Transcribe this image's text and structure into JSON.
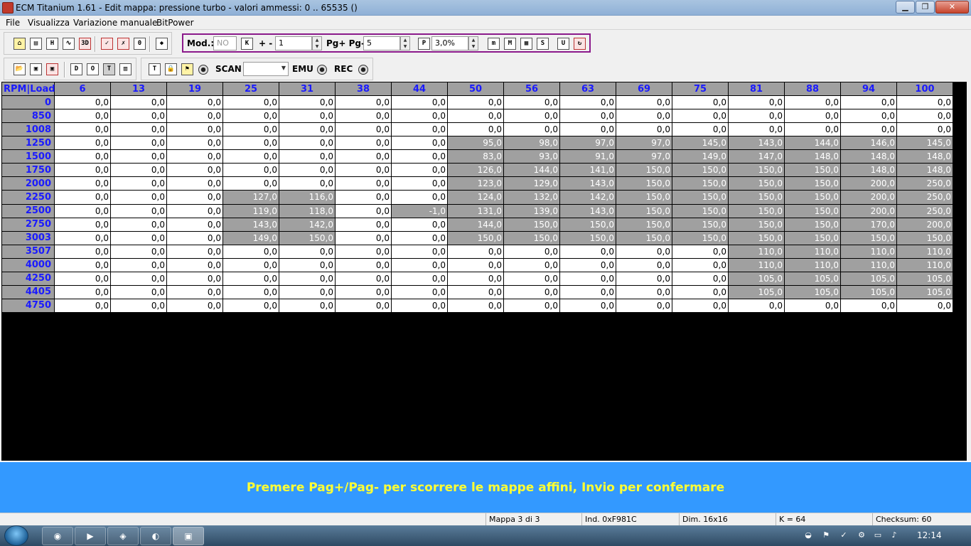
{
  "window": {
    "title": "ECM Titanium 1.61 - Edit mappa: pressione turbo - valori ammessi: 0 .. 65535 ()"
  },
  "menu": [
    "File",
    "Visualizza",
    "Variazione manuale",
    "BitPower"
  ],
  "toolbar1": {
    "mod_label": "Mod.:",
    "mod_value": "NO",
    "plusminus_label": "+ -",
    "step_value": "1",
    "page_label": "Pg+ Pg-",
    "page_value": "5",
    "percent_value": "3,0%"
  },
  "toolbar2": {
    "scan_label": "SCAN",
    "emu_label": "EMU",
    "rec_label": "REC"
  },
  "map": {
    "corner": "RPM|Load",
    "columns": [
      "6",
      "13",
      "19",
      "25",
      "31",
      "38",
      "44",
      "50",
      "56",
      "63",
      "69",
      "75",
      "81",
      "88",
      "94",
      "100"
    ],
    "rows": [
      {
        "rpm": "0",
        "values": [
          "0,0",
          "0,0",
          "0,0",
          "0,0",
          "0,0",
          "0,0",
          "0,0",
          "0,0",
          "0,0",
          "0,0",
          "0,0",
          "0,0",
          "0,0",
          "0,0",
          "0,0",
          "0,0"
        ]
      },
      {
        "rpm": "850",
        "values": [
          "0,0",
          "0,0",
          "0,0",
          "0,0",
          "0,0",
          "0,0",
          "0,0",
          "0,0",
          "0,0",
          "0,0",
          "0,0",
          "0,0",
          "0,0",
          "0,0",
          "0,0",
          "0,0"
        ]
      },
      {
        "rpm": "1008",
        "values": [
          "0,0",
          "0,0",
          "0,0",
          "0,0",
          "0,0",
          "0,0",
          "0,0",
          "0,0",
          "0,0",
          "0,0",
          "0,0",
          "0,0",
          "0,0",
          "0,0",
          "0,0",
          "0,0"
        ]
      },
      {
        "rpm": "1250",
        "values": [
          "0,0",
          "0,0",
          "0,0",
          "0,0",
          "0,0",
          "0,0",
          "0,0",
          "95,0",
          "98,0",
          "97,0",
          "97,0",
          "145,0",
          "143,0",
          "144,0",
          "146,0",
          "145,0"
        ]
      },
      {
        "rpm": "1500",
        "values": [
          "0,0",
          "0,0",
          "0,0",
          "0,0",
          "0,0",
          "0,0",
          "0,0",
          "83,0",
          "93,0",
          "91,0",
          "97,0",
          "149,0",
          "147,0",
          "148,0",
          "148,0",
          "148,0"
        ]
      },
      {
        "rpm": "1750",
        "values": [
          "0,0",
          "0,0",
          "0,0",
          "0,0",
          "0,0",
          "0,0",
          "0,0",
          "126,0",
          "144,0",
          "141,0",
          "150,0",
          "150,0",
          "150,0",
          "150,0",
          "148,0",
          "148,0"
        ]
      },
      {
        "rpm": "2000",
        "values": [
          "0,0",
          "0,0",
          "0,0",
          "0,0",
          "0,0",
          "0,0",
          "0,0",
          "123,0",
          "129,0",
          "143,0",
          "150,0",
          "150,0",
          "150,0",
          "150,0",
          "200,0",
          "250,0"
        ]
      },
      {
        "rpm": "2250",
        "values": [
          "0,0",
          "0,0",
          "0,0",
          "127,0",
          "116,0",
          "0,0",
          "0,0",
          "124,0",
          "132,0",
          "142,0",
          "150,0",
          "150,0",
          "150,0",
          "150,0",
          "200,0",
          "250,0"
        ]
      },
      {
        "rpm": "2500",
        "values": [
          "0,0",
          "0,0",
          "0,0",
          "119,0",
          "118,0",
          "0,0",
          "-1,0",
          "131,0",
          "139,0",
          "143,0",
          "150,0",
          "150,0",
          "150,0",
          "150,0",
          "200,0",
          "250,0"
        ]
      },
      {
        "rpm": "2750",
        "values": [
          "0,0",
          "0,0",
          "0,0",
          "143,0",
          "142,0",
          "0,0",
          "0,0",
          "144,0",
          "150,0",
          "150,0",
          "150,0",
          "150,0",
          "150,0",
          "150,0",
          "170,0",
          "200,0"
        ]
      },
      {
        "rpm": "3003",
        "values": [
          "0,0",
          "0,0",
          "0,0",
          "149,0",
          "150,0",
          "0,0",
          "0,0",
          "150,0",
          "150,0",
          "150,0",
          "150,0",
          "150,0",
          "150,0",
          "150,0",
          "150,0",
          "150,0"
        ]
      },
      {
        "rpm": "3507",
        "values": [
          "0,0",
          "0,0",
          "0,0",
          "0,0",
          "0,0",
          "0,0",
          "0,0",
          "0,0",
          "0,0",
          "0,0",
          "0,0",
          "0,0",
          "110,0",
          "110,0",
          "110,0",
          "110,0"
        ]
      },
      {
        "rpm": "4000",
        "values": [
          "0,0",
          "0,0",
          "0,0",
          "0,0",
          "0,0",
          "0,0",
          "0,0",
          "0,0",
          "0,0",
          "0,0",
          "0,0",
          "0,0",
          "110,0",
          "110,0",
          "110,0",
          "110,0"
        ]
      },
      {
        "rpm": "4250",
        "values": [
          "0,0",
          "0,0",
          "0,0",
          "0,0",
          "0,0",
          "0,0",
          "0,0",
          "0,0",
          "0,0",
          "0,0",
          "0,0",
          "0,0",
          "105,0",
          "105,0",
          "105,0",
          "105,0"
        ]
      },
      {
        "rpm": "4405",
        "values": [
          "0,0",
          "0,0",
          "0,0",
          "0,0",
          "0,0",
          "0,0",
          "0,0",
          "0,0",
          "0,0",
          "0,0",
          "0,0",
          "0,0",
          "105,0",
          "105,0",
          "105,0",
          "105,0"
        ]
      },
      {
        "rpm": "4750",
        "values": [
          "0,0",
          "0,0",
          "0,0",
          "0,0",
          "0,0",
          "0,0",
          "0,0",
          "0,0",
          "0,0",
          "0,0",
          "0,0",
          "0,0",
          "0,0",
          "0,0",
          "0,0",
          "0,0"
        ]
      }
    ]
  },
  "hint": "Premere Pag+/Pag- per scorrere le mappe affini, Invio per confermare",
  "status": {
    "map": "Mappa 3 di 3",
    "index": "Ind. 0xF981C",
    "dim": "Dim. 16x16",
    "k": "K = 64",
    "checksum": "Checksum: 60"
  },
  "taskbar": {
    "clock": "12:14"
  },
  "colors": {
    "header_text": "#1a1aff",
    "header_bg": "#a0a0a0",
    "hint_bg": "#3399ff",
    "hint_text": "#ffff33"
  }
}
